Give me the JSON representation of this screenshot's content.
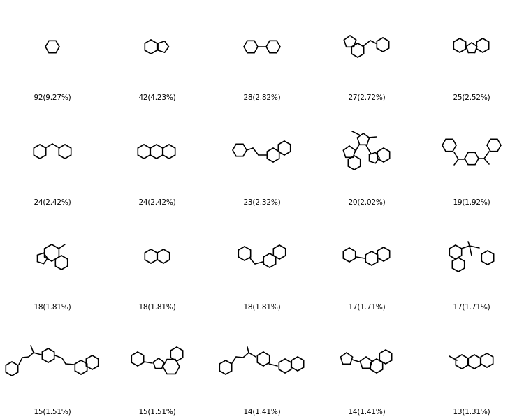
{
  "cells": [
    {
      "label": "92(9.27%)",
      "count": 92,
      "percent": 9.27,
      "structure": "benzene"
    },
    {
      "label": "42(4.23%)",
      "count": 42,
      "percent": 4.23,
      "structure": "indane"
    },
    {
      "label": "28(2.82%)",
      "count": 28,
      "percent": 2.82,
      "structure": "biphenyl"
    },
    {
      "label": "27(2.72%)",
      "count": 27,
      "percent": 2.72,
      "structure": "indanyl-methyl-benzene"
    },
    {
      "label": "25(2.52%)",
      "count": 25,
      "percent": 2.52,
      "structure": "fluorene"
    },
    {
      "label": "24(2.42%)",
      "count": 24,
      "percent": 2.42,
      "structure": "diphenylmethane"
    },
    {
      "label": "24(2.42%)",
      "count": 24,
      "percent": 2.42,
      "structure": "anthracene"
    },
    {
      "label": "23(2.32%)",
      "count": 23,
      "percent": 2.32,
      "structure": "phenylethyl-naphthalene"
    },
    {
      "label": "20(2.02%)",
      "count": 20,
      "percent": 2.02,
      "structure": "bis-indanyl-cyclopentane"
    },
    {
      "label": "19(1.92%)",
      "count": 19,
      "percent": 1.92,
      "structure": "bis-phenylethyl-benzene"
    },
    {
      "label": "18(1.81%)",
      "count": 18,
      "percent": 1.81,
      "structure": "methyl-fused-tricycle"
    },
    {
      "label": "18(1.81%)",
      "count": 18,
      "percent": 1.81,
      "structure": "naphthalene"
    },
    {
      "label": "18(1.81%)",
      "count": 18,
      "percent": 1.81,
      "structure": "benzyl-naphthalene"
    },
    {
      "label": "17(1.71%)",
      "count": 17,
      "percent": 1.71,
      "structure": "phenyl-naphthalene"
    },
    {
      "label": "17(1.71%)",
      "count": 17,
      "percent": 1.71,
      "structure": "dimethyl-phenyl-indane"
    },
    {
      "label": "15(1.51%)",
      "count": 15,
      "percent": 1.51,
      "structure": "long-chain-phenyl-naphthalene"
    },
    {
      "label": "15(1.51%)",
      "count": 15,
      "percent": 1.51,
      "structure": "phenyl-fused-tricycle"
    },
    {
      "label": "14(1.41%)",
      "count": 14,
      "percent": 1.41,
      "structure": "chain-phenyl-naphthalene"
    },
    {
      "label": "14(1.41%)",
      "count": 14,
      "percent": 1.41,
      "structure": "cyclopentyl-fluorene"
    },
    {
      "label": "13(1.31%)",
      "count": 13,
      "percent": 1.31,
      "structure": "methyl-anthracene"
    }
  ]
}
